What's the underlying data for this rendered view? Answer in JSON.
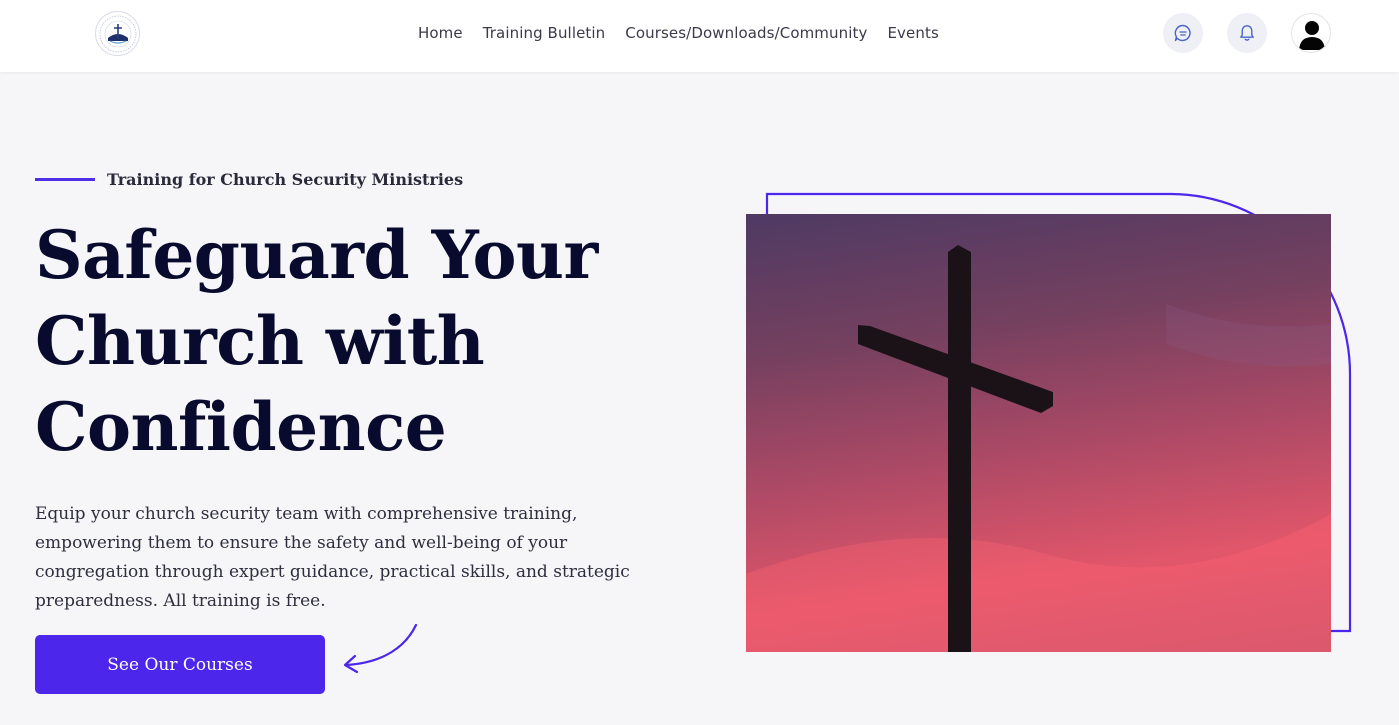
{
  "nav": {
    "logo_alt": "logo",
    "links": [
      "Home",
      "Training Bulletin",
      "Courses/Downloads/Community",
      "Events"
    ]
  },
  "icons": {
    "chat": "chat-bubble-icon",
    "notifications": "bell-icon",
    "user": "user-avatar-icon"
  },
  "hero": {
    "eyebrow": "Training for Church Security Ministries",
    "headline_lines": [
      "Safeguard Your",
      "Church with",
      "Confidence"
    ],
    "description": "Equip your church security team with comprehensive training, empowering them to ensure the safety and well-being of your congregation through expert guidance, practical skills, and strategic preparedness. All training is free.",
    "cta_label": "See Our Courses"
  },
  "colors": {
    "accent": "#4c26ea",
    "heading": "#080b2e",
    "background": "#f6f6f9"
  }
}
